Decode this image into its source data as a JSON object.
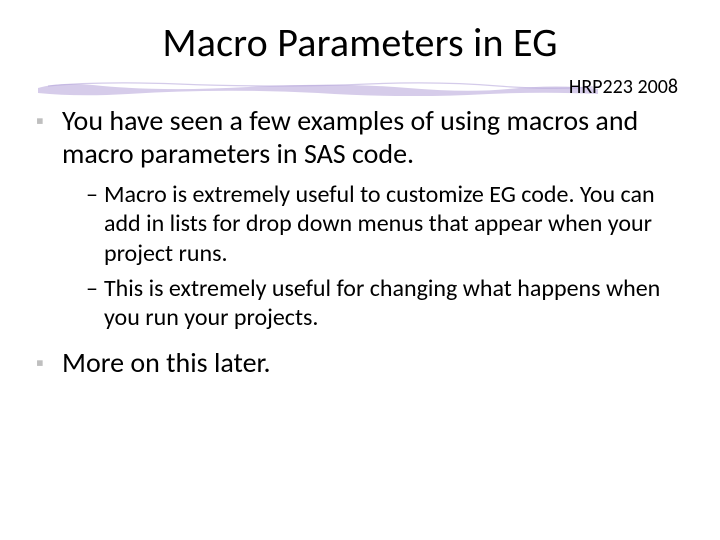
{
  "title": "Macro Parameters in EG",
  "course_label": "HRP223 2008",
  "bullets": {
    "b1": "You have seen a few examples of using macros and macro parameters in SAS code.",
    "b2": "More on this later."
  },
  "subbullets": {
    "s1": "Macro is extremely useful to customize EG code. You can add in lists for drop down menus that appear when your project runs.",
    "s2": "This is extremely useful for changing what happens when you run your projects."
  },
  "glyphs": {
    "square": "▪",
    "dash": "–"
  }
}
